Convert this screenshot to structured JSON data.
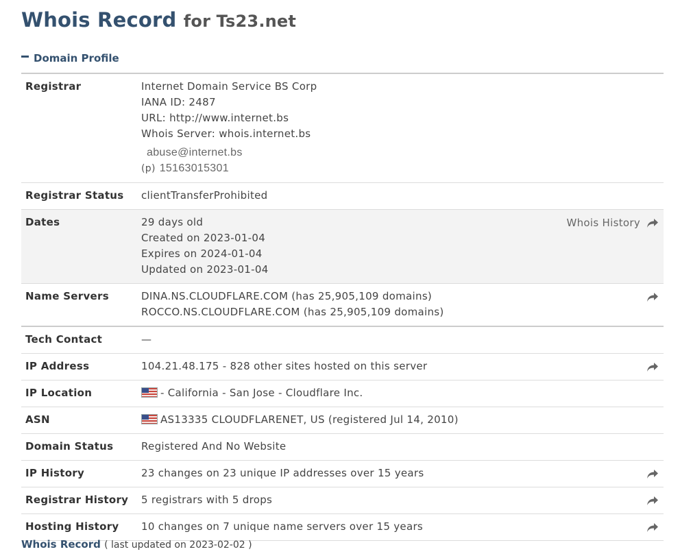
{
  "header": {
    "title": "Whois Record",
    "for_text": "for Ts23.net"
  },
  "section": {
    "toggle_label": "Domain Profile"
  },
  "rows": {
    "registrar": {
      "label": "Registrar",
      "name": "Internet Domain Service BS Corp",
      "iana": "IANA ID: 2487",
      "url": "URL: http://www.internet.bs",
      "whois_server": "Whois Server: whois.internet.bs",
      "email": "abuse@internet.bs",
      "phone_prefix": "(p)",
      "phone": "15163015301"
    },
    "registrar_status": {
      "label": "Registrar Status",
      "value": "clientTransferProhibited"
    },
    "dates": {
      "label": "Dates",
      "age": "29 days old",
      "created": "Created on 2023-01-04",
      "expires": "Expires on 2024-01-04",
      "updated": "Updated on 2023-01-04",
      "action_label": "Whois History"
    },
    "name_servers": {
      "label": "Name Servers",
      "ns1": "DINA.NS.CLOUDFLARE.COM (has 25,905,109 domains)",
      "ns2": "ROCCO.NS.CLOUDFLARE.COM (has 25,905,109 domains)"
    },
    "tech_contact": {
      "label": "Tech Contact",
      "value": "—"
    },
    "ip_address": {
      "label": "IP Address",
      "value": "104.21.48.175 - 828 other sites hosted on this server"
    },
    "ip_location": {
      "label": "IP Location",
      "value": "- California - San Jose - Cloudflare Inc."
    },
    "asn": {
      "label": "ASN",
      "value": "AS13335 CLOUDFLARENET, US (registered Jul 14, 2010)"
    },
    "domain_status": {
      "label": "Domain Status",
      "value": "Registered And No Website"
    },
    "ip_history": {
      "label": "IP History",
      "value": "23 changes on 23 unique IP addresses over 15 years"
    },
    "registrar_history": {
      "label": "Registrar History",
      "value": "5 registrars with 5 drops"
    },
    "hosting_history": {
      "label": "Hosting History",
      "value": "10 changes on 7 unique name servers over 15 years"
    }
  },
  "footer": {
    "link": "Whois Record",
    "note": "( last updated on 2023-02-02 )"
  },
  "icons": {
    "share": "share-arrow-icon",
    "flag": "us-flag-icon"
  },
  "colors": {
    "heading": "#34516f",
    "shaded_row": "#f3f3f3"
  }
}
